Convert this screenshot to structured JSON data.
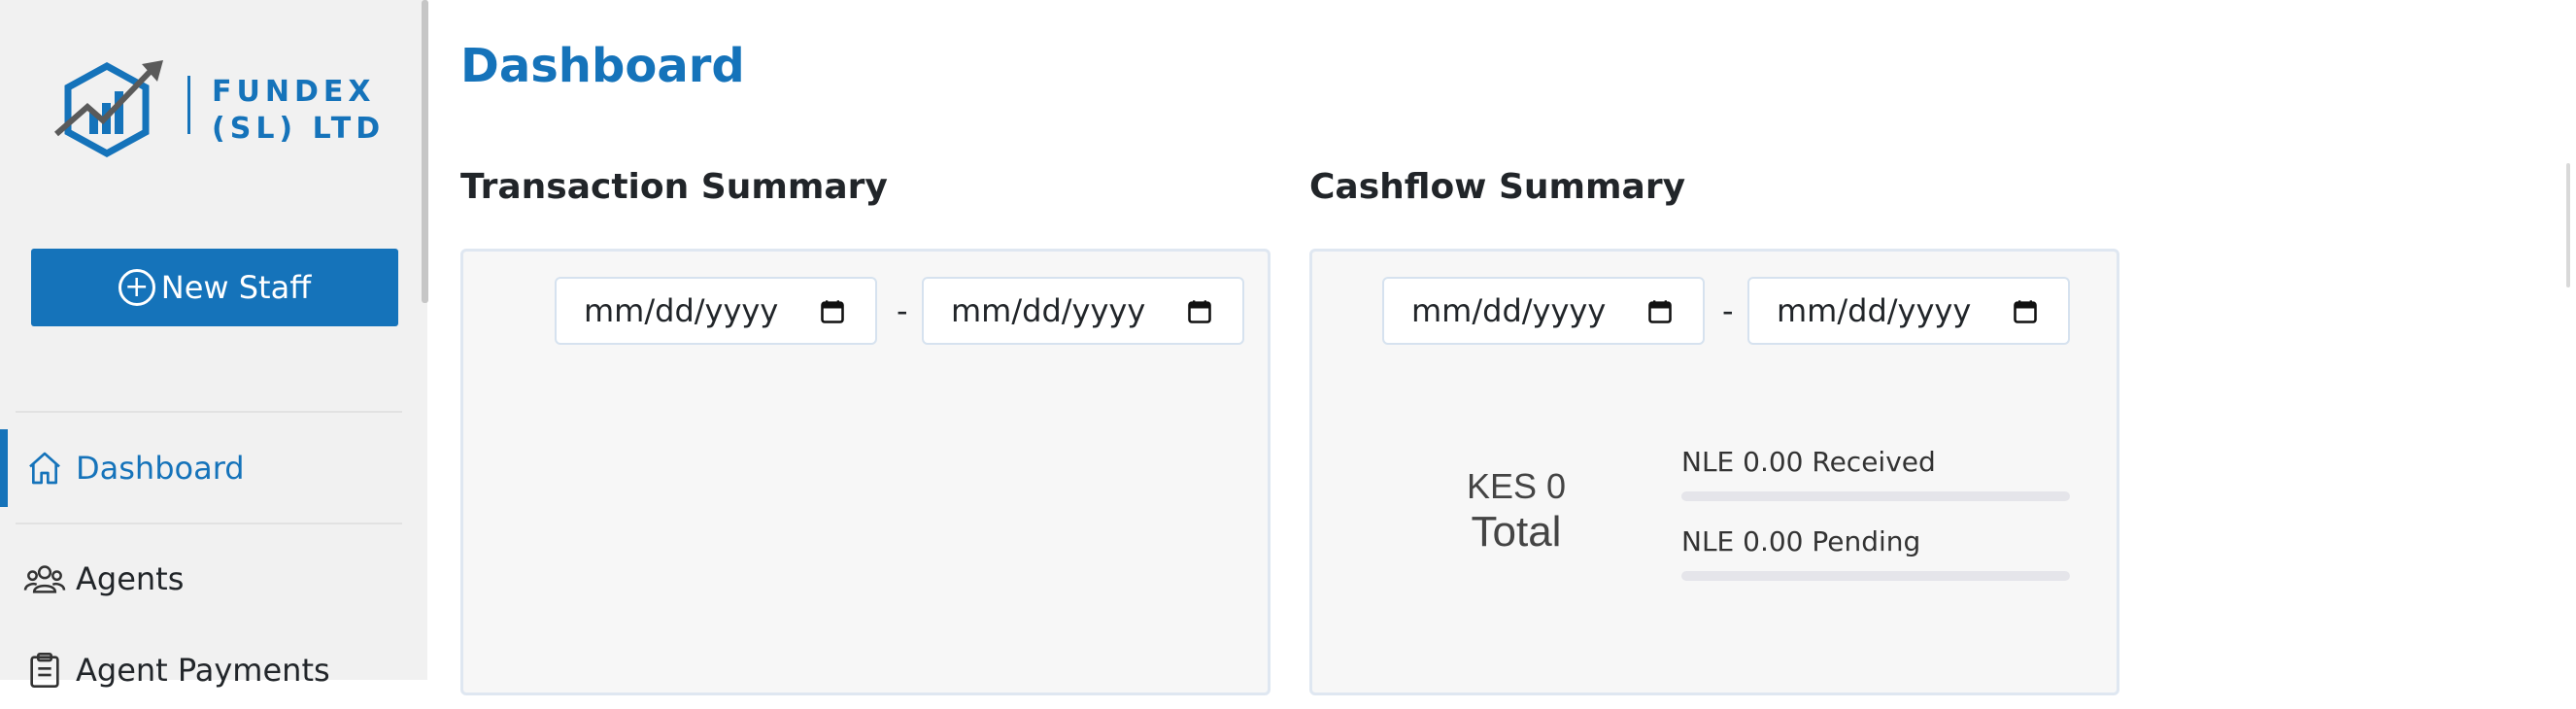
{
  "brand": {
    "line1": "FUNDEX",
    "line2": "(SL) LTD",
    "color": "#1573ba"
  },
  "sidebar": {
    "new_staff_label": "New Staff",
    "items": [
      {
        "label": "Dashboard",
        "icon": "home-icon",
        "active": true
      },
      {
        "label": "Agents",
        "icon": "users-icon",
        "active": false
      },
      {
        "label": "Agent Payments",
        "icon": "clipboard-icon",
        "active": false
      }
    ]
  },
  "page": {
    "title": "Dashboard"
  },
  "transaction_summary": {
    "title": "Transaction Summary",
    "date_from_placeholder": "mm/dd/yyyy",
    "date_to_placeholder": "mm/dd/yyyy",
    "separator": "-"
  },
  "cashflow_summary": {
    "title": "Cashflow Summary",
    "date_from_placeholder": "mm/dd/yyyy",
    "date_to_placeholder": "mm/dd/yyyy",
    "separator": "-",
    "total_amount": "KES 0",
    "total_label": "Total",
    "received_label": "NLE 0.00 Received",
    "received_progress": 0,
    "pending_label": "NLE 0.00 Pending",
    "pending_progress": 0
  },
  "colors": {
    "accent": "#1573ba",
    "sidebar_bg": "#f1f1f1",
    "card_bg": "#f7f7f7"
  }
}
